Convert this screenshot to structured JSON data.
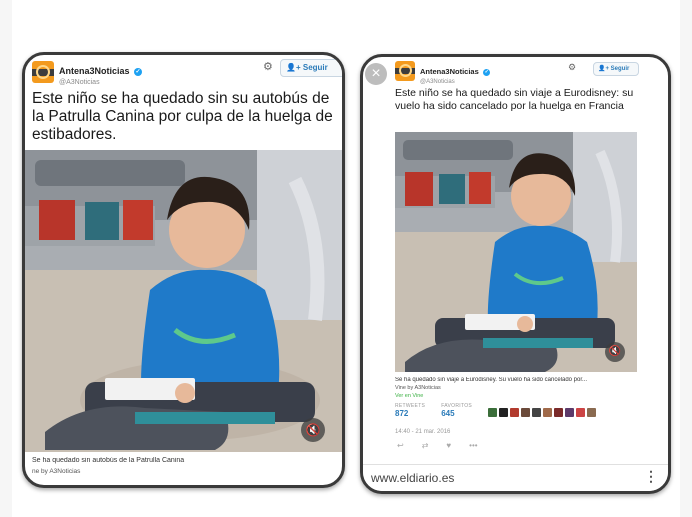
{
  "left": {
    "account_name": "Antena3Noticias",
    "account_handle": "@A3Noticias",
    "follow_label": "Seguir",
    "tweet_text": "Este niño se ha quedado sin su autobús de la Patrulla Canina por culpa de la huelga de estibadores.",
    "caption": "Se ha quedado sin autobús de la Patrulla Canina",
    "vine_by": "ne by A3Noticias"
  },
  "right": {
    "account_name": "Antena3Noticias",
    "account_handle": "@A3Noticias",
    "follow_label": "Seguir",
    "tweet_text": "Este niño se ha quedado sin viaje a Eurodisney: su vuelo ha sido cancelado por la huelga en Francia",
    "caption": "Se ha quedado sin viaje a Eurodisney. Su vuelo ha sido cancelado por...",
    "vine_by": "Vine by A3Noticias",
    "view_on_vine": "Ver en Vine",
    "retweets_label": "RETWEETS",
    "retweets": "872",
    "favorites_label": "FAVORITOS",
    "favorites": "645",
    "timestamp": "14:40 - 21 mar. 2016",
    "url": "www.eldiario.es"
  },
  "colors": {
    "brand_orange": "#f39a1e",
    "link_blue": "#2b7bb9",
    "verified_blue": "#1da1f2",
    "sweater_blue": "#1f7ac9"
  },
  "icons": [
    "gear-icon",
    "follow-user-icon",
    "verified-icon",
    "mute-icon",
    "close-icon",
    "reply-icon",
    "retweet-icon",
    "favorite-icon",
    "more-icon",
    "kebab-menu-icon"
  ]
}
